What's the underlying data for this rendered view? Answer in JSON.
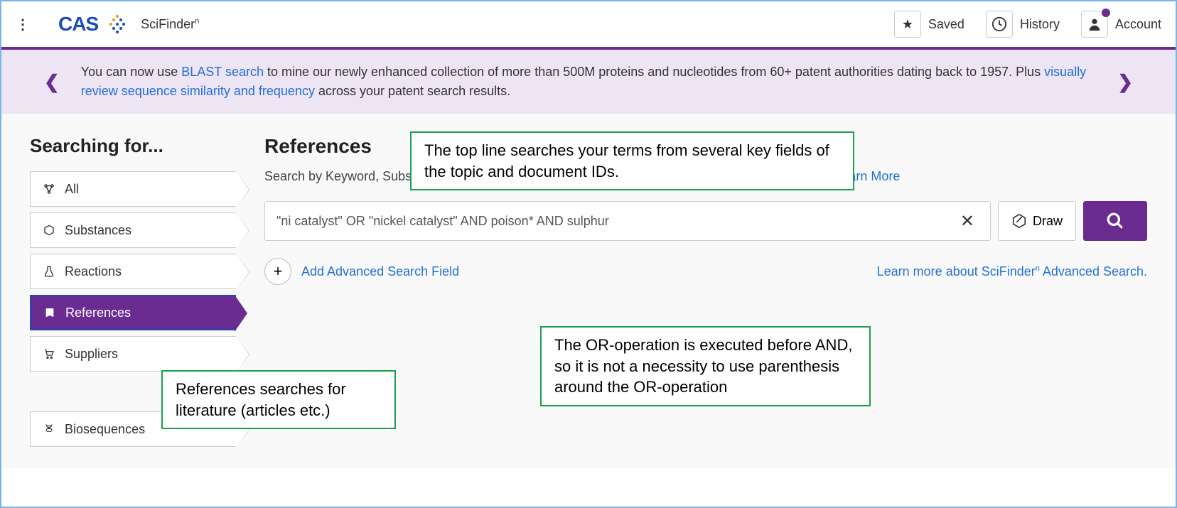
{
  "header": {
    "logo_text": "CAS",
    "brand": "SciFinder",
    "brand_sup": "n",
    "saved": "Saved",
    "history": "History",
    "account": "Account"
  },
  "banner": {
    "text_1": "You can now use ",
    "link_1": "BLAST search",
    "text_2": " to mine our newly enhanced collection of more than 500M proteins and nucleotides from 60+ patent authorities dating back to 1957. Plus ",
    "link_2": "visually review sequence similarity and frequency",
    "text_3": " across your patent search results."
  },
  "sidebar": {
    "heading": "Searching for...",
    "tabs": {
      "all": "All",
      "substances": "Substances",
      "reactions": "Reactions",
      "references": "References",
      "suppliers": "Suppliers",
      "biosequences": "Biosequences"
    }
  },
  "content": {
    "heading": "References",
    "subtext_1": "Search by Keyword, Substance Name, CAS RN, Patent Number, PubMed ID, AN, CAN, and/or DOI. ",
    "subtext_link": "Learn More",
    "search_value": "\"ni catalyst\" OR \"nickel catalyst\" AND poison* AND sulphur",
    "draw_label": "Draw",
    "add_field": "Add Advanced Search Field",
    "adv_learn_1": "Learn more about SciFinder",
    "adv_learn_sup": "n",
    "adv_learn_2": " Advanced Search."
  },
  "callouts": {
    "c1": "The top line searches your terms from several key fields of the topic and document IDs.",
    "c2": "References searches for literature (articles etc.)",
    "c3": "The OR-operation is executed before AND, so it is not a necessity to use parenthesis around the OR-operation"
  }
}
